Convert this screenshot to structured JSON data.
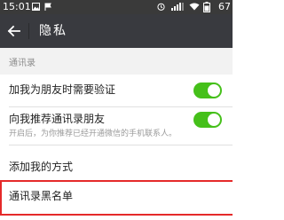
{
  "status_bar": {
    "time": "15:01",
    "battery_pct": "67",
    "icons": [
      "image-icon",
      "flag-icon",
      "alarm-icon",
      "signal-icon",
      "wifi-icon",
      "battery-icon"
    ]
  },
  "title_bar": {
    "back_icon": "arrow-left-icon",
    "title": "隐私"
  },
  "section": {
    "header": "通讯录"
  },
  "rows": [
    {
      "label": "加我为朋友时需要验证",
      "toggle": true
    },
    {
      "label": "向我推荐通讯录朋友",
      "sub": "开启后，为你推荐已经开通微信的手机联系人。",
      "toggle": true
    },
    {
      "label": "添加我的方式"
    },
    {
      "label": "通讯录黑名单"
    }
  ],
  "colors": {
    "status_bar": "#3a3a3a",
    "title_bar": "#393a3f",
    "toggle_on": "#45c01a",
    "highlight": "#e52a2a",
    "background": "#f2f2f2"
  }
}
